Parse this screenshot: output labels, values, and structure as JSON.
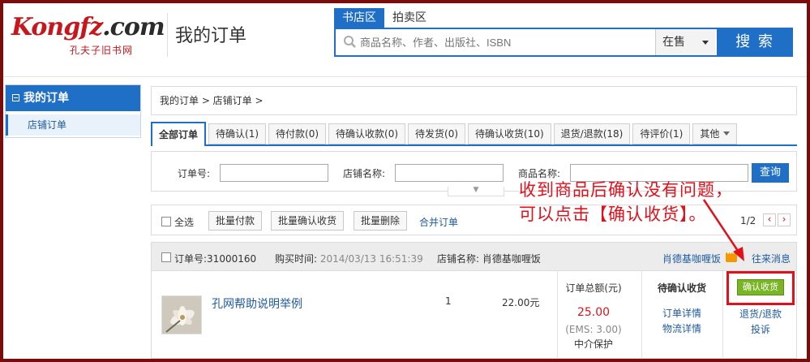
{
  "header": {
    "logo_main_red": "Kongfz",
    "logo_main_dark": ".com",
    "logo_sub": "孔夫子旧书网",
    "page_title": "我的订单",
    "search_tabs": [
      "书店区",
      "拍卖区"
    ],
    "search_placeholder": "商品名称、作者、出版社、ISBN",
    "search_scope": "在售",
    "search_button": "搜 索"
  },
  "sidebar": {
    "heading": "我的订单",
    "items": [
      "店铺订单"
    ]
  },
  "breadcrumb": "我的订单 > 店铺订单 >",
  "tabs": [
    {
      "label": "全部订单",
      "active": true
    },
    {
      "label": "待确认(1)"
    },
    {
      "label": "待付款(0)"
    },
    {
      "label": "待确认收款(0)"
    },
    {
      "label": "待发货(0)"
    },
    {
      "label": "待确认收货(10)"
    },
    {
      "label": "退货/退款(18)"
    },
    {
      "label": "待评价(1)"
    },
    {
      "label": "其他"
    }
  ],
  "filter": {
    "order_no_label": "订单号:",
    "shop_name_label": "店铺名称:",
    "product_name_label": "商品名称:",
    "query_button": "查询"
  },
  "actions": {
    "select_all": "全选",
    "batch_pay": "批量付款",
    "batch_confirm": "批量确认收货",
    "batch_delete": "批量删除",
    "merge": "合并订单",
    "pager": "1/2"
  },
  "order": {
    "order_no_label": "订单号:",
    "order_no": "31000160",
    "buy_time_label": "购买时间:",
    "buy_time": "2014/03/13 16:51:39",
    "shop_label": "店铺名称:",
    "shop_name": "肖德基咖喱饭",
    "shop_link": "肖德基咖喱饭",
    "history_msg": "往来消息",
    "item_title": "孔网帮助说明举例",
    "quantity": "1",
    "price": "22.00元",
    "total_label": "订单总额(元)",
    "total": "25.00",
    "shipping": "(EMS: 3.00)",
    "escrow": "中介保护",
    "status": "待确认收货",
    "detail_link": "订单详情",
    "logistics_link": "物流详情",
    "confirm_button": "确认收货",
    "refund_link": "退货/退款",
    "complain_link": "投诉"
  },
  "annotation": {
    "line1": "收到商品后确认没有问题，",
    "line2": "可以点击【确认收货】。"
  },
  "colors": {
    "brand_blue": "#1f6fc7",
    "brand_red": "#c8161d",
    "confirm_green": "#7ab526",
    "annotation_red": "#e2101b",
    "frame": "#7a0c0c"
  }
}
